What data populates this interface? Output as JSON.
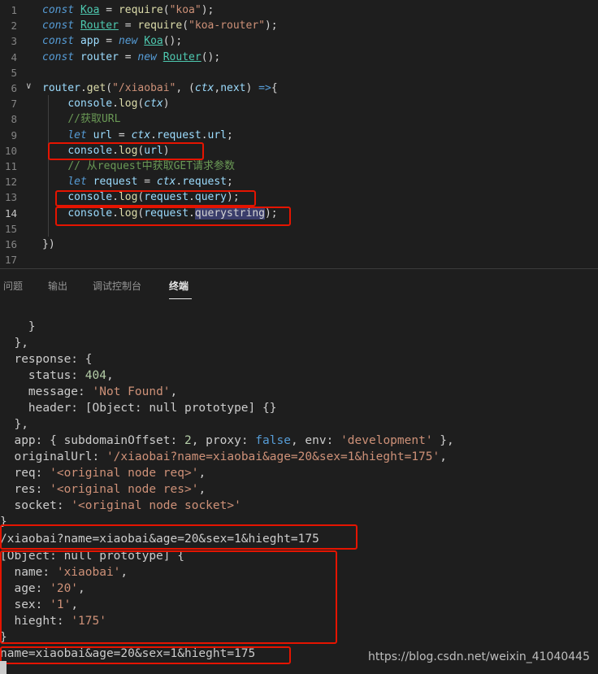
{
  "editor": {
    "lines": [
      {
        "num": "1",
        "parts": [
          [
            "kw",
            "const "
          ],
          [
            "cls",
            "Koa"
          ],
          [
            "op",
            " = "
          ],
          [
            "fn",
            "require"
          ],
          [
            "op",
            "("
          ],
          [
            "str",
            "\"koa\""
          ],
          [
            "op",
            ");"
          ]
        ]
      },
      {
        "num": "2",
        "parts": [
          [
            "kw",
            "const "
          ],
          [
            "cls",
            "Router"
          ],
          [
            "op",
            " = "
          ],
          [
            "fn",
            "require"
          ],
          [
            "op",
            "("
          ],
          [
            "str",
            "\"koa-router\""
          ],
          [
            "op",
            ");"
          ]
        ]
      },
      {
        "num": "3",
        "parts": [
          [
            "kw",
            "const "
          ],
          [
            "var",
            "app"
          ],
          [
            "op",
            " = "
          ],
          [
            "kw2",
            "new "
          ],
          [
            "cls",
            "Koa"
          ],
          [
            "op",
            "();"
          ]
        ]
      },
      {
        "num": "4",
        "parts": [
          [
            "kw",
            "const "
          ],
          [
            "var",
            "router"
          ],
          [
            "op",
            " = "
          ],
          [
            "kw2",
            "new "
          ],
          [
            "cls",
            "Router"
          ],
          [
            "op",
            "();"
          ]
        ]
      },
      {
        "num": "5",
        "parts": []
      },
      {
        "num": "6",
        "parts": [
          [
            "var",
            "router"
          ],
          [
            "op",
            "."
          ],
          [
            "fn",
            "get"
          ],
          [
            "op",
            "("
          ],
          [
            "str",
            "\"/xiaobai\""
          ],
          [
            "op",
            ", ("
          ],
          [
            "ital",
            "ctx"
          ],
          [
            "op",
            ","
          ],
          [
            "var",
            "next"
          ],
          [
            "op",
            ") "
          ],
          [
            "kw2",
            "=>"
          ],
          [
            "op",
            "{"
          ]
        ]
      },
      {
        "num": "7",
        "parts": [
          [
            "op",
            "    "
          ],
          [
            "var",
            "console"
          ],
          [
            "op",
            "."
          ],
          [
            "fn",
            "log"
          ],
          [
            "op",
            "("
          ],
          [
            "ital",
            "ctx"
          ],
          [
            "op",
            ")"
          ]
        ]
      },
      {
        "num": "8",
        "parts": [
          [
            "op",
            "    "
          ],
          [
            "cmt",
            "//获取URL"
          ]
        ]
      },
      {
        "num": "9",
        "parts": [
          [
            "op",
            "    "
          ],
          [
            "kw",
            "let "
          ],
          [
            "var",
            "url"
          ],
          [
            "op",
            " = "
          ],
          [
            "ital",
            "ctx"
          ],
          [
            "op",
            "."
          ],
          [
            "var",
            "request"
          ],
          [
            "op",
            "."
          ],
          [
            "var",
            "url"
          ],
          [
            "op",
            ";"
          ]
        ]
      },
      {
        "num": "10",
        "parts": [
          [
            "op",
            "    "
          ],
          [
            "var",
            "console"
          ],
          [
            "op",
            "."
          ],
          [
            "fn",
            "log"
          ],
          [
            "op",
            "("
          ],
          [
            "var",
            "url"
          ],
          [
            "op",
            ")"
          ]
        ]
      },
      {
        "num": "11",
        "parts": [
          [
            "op",
            "    "
          ],
          [
            "cmt",
            "// 从request中获取GET请求参数"
          ]
        ]
      },
      {
        "num": "12",
        "parts": [
          [
            "op",
            "    "
          ],
          [
            "kw",
            "let "
          ],
          [
            "var",
            "request"
          ],
          [
            "op",
            " = "
          ],
          [
            "ital",
            "ctx"
          ],
          [
            "op",
            "."
          ],
          [
            "var",
            "request"
          ],
          [
            "op",
            ";"
          ]
        ]
      },
      {
        "num": "13",
        "parts": [
          [
            "op",
            "    "
          ],
          [
            "var",
            "console"
          ],
          [
            "op",
            "."
          ],
          [
            "fn",
            "log"
          ],
          [
            "op",
            "("
          ],
          [
            "var",
            "request"
          ],
          [
            "op",
            "."
          ],
          [
            "var",
            "query"
          ],
          [
            "op",
            ");"
          ]
        ]
      },
      {
        "num": "14",
        "parts": [
          [
            "op",
            "    "
          ],
          [
            "var",
            "console"
          ],
          [
            "op",
            "."
          ],
          [
            "fn",
            "log"
          ],
          [
            "op",
            "("
          ],
          [
            "var",
            "request"
          ],
          [
            "op",
            "."
          ],
          [
            "hl",
            "querystring"
          ],
          [
            "op",
            ");"
          ]
        ]
      },
      {
        "num": "15",
        "parts": []
      },
      {
        "num": "16",
        "parts": [
          [
            "op",
            "})"
          ]
        ]
      },
      {
        "num": "17",
        "parts": []
      }
    ],
    "fold_marker": "∨"
  },
  "panel": {
    "tabs": [
      {
        "label": "问题"
      },
      {
        "label": "输出"
      },
      {
        "label": "调试控制台"
      },
      {
        "label": "终端",
        "active": true
      }
    ]
  },
  "terminal": {
    "lines": [
      [
        [
          "p",
          "    }"
        ]
      ],
      [
        [
          "p",
          "  },"
        ]
      ],
      [
        [
          "p",
          "  response: {"
        ]
      ],
      [
        [
          "p",
          "    status: "
        ],
        [
          "n",
          "404"
        ],
        [
          "p",
          ","
        ]
      ],
      [
        [
          "p",
          "    message: "
        ],
        [
          "s",
          "'Not Found'"
        ],
        [
          "p",
          ","
        ]
      ],
      [
        [
          "p",
          "    header: [Object: null prototype] {}"
        ]
      ],
      [
        [
          "p",
          "  },"
        ]
      ],
      [
        [
          "p",
          "  app: { subdomainOffset: "
        ],
        [
          "n",
          "2"
        ],
        [
          "p",
          ", proxy: "
        ],
        [
          "b",
          "false"
        ],
        [
          "p",
          ", env: "
        ],
        [
          "s",
          "'development'"
        ],
        [
          "p",
          " },"
        ]
      ],
      [
        [
          "p",
          "  originalUrl: "
        ],
        [
          "s",
          "'/xiaobai?name=xiaobai&age=20&sex=1&hieght=175'"
        ],
        [
          "p",
          ","
        ]
      ],
      [
        [
          "p",
          "  req: "
        ],
        [
          "s",
          "'<original node req>'"
        ],
        [
          "p",
          ","
        ]
      ],
      [
        [
          "p",
          "  res: "
        ],
        [
          "s",
          "'<original node res>'"
        ],
        [
          "p",
          ","
        ]
      ],
      [
        [
          "p",
          "  socket: "
        ],
        [
          "s",
          "'<original node socket>'"
        ]
      ],
      [
        [
          "p",
          "}"
        ]
      ],
      [
        [
          "p",
          "/xiaobai?name=xiaobai&age=20&sex=1&hieght=175"
        ]
      ],
      [
        [
          "p",
          "[Object: null prototype] {"
        ]
      ],
      [
        [
          "p",
          "  name: "
        ],
        [
          "s",
          "'xiaobai'"
        ],
        [
          "p",
          ","
        ]
      ],
      [
        [
          "p",
          "  age: "
        ],
        [
          "s",
          "'20'"
        ],
        [
          "p",
          ","
        ]
      ],
      [
        [
          "p",
          "  sex: "
        ],
        [
          "s",
          "'1'"
        ],
        [
          "p",
          ","
        ]
      ],
      [
        [
          "p",
          "  hieght: "
        ],
        [
          "s",
          "'175'"
        ]
      ],
      [
        [
          "p",
          "}"
        ]
      ],
      [
        [
          "p",
          "name=xiaobai&age=20&sex=1&hieght=175"
        ]
      ]
    ]
  },
  "watermark": "https://blog.csdn.net/weixin_41040445",
  "colors": {
    "highlight_box": "#e51400",
    "background": "#1e1e1e"
  }
}
